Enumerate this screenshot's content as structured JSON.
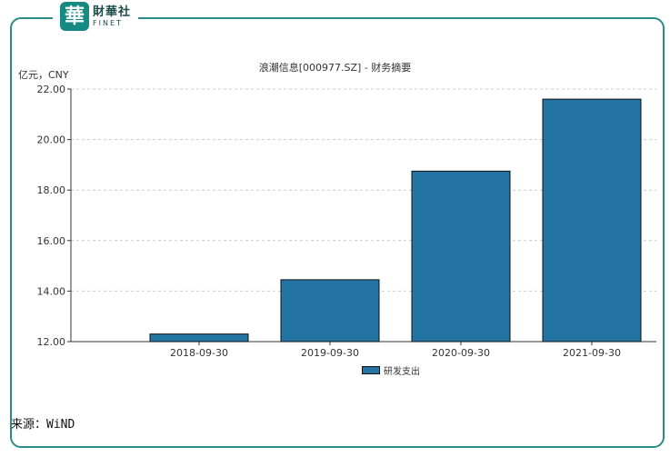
{
  "brand": {
    "seal": "華",
    "name_cn": "財華社",
    "name_en": "FINET"
  },
  "colors": {
    "frame": "#2a8a88",
    "bar": "#2474a3",
    "grid": "#cccccc"
  },
  "source": "来源：WiND",
  "chart_data": {
    "type": "bar",
    "title": "浪潮信息[000977.SZ] - 财务摘要",
    "ylabel": "亿元，CNY",
    "xlabel": "",
    "categories": [
      "2018-09-30",
      "2019-09-30",
      "2020-09-30",
      "2021-09-30"
    ],
    "series": [
      {
        "name": "研发支出",
        "values": [
          12.3,
          14.45,
          18.75,
          21.6
        ]
      }
    ],
    "ylim": [
      12,
      22
    ],
    "yticks": [
      "12.00",
      "14.00",
      "16.00",
      "18.00",
      "20.00",
      "22.00"
    ],
    "grid": true,
    "legend_position": "bottom"
  }
}
